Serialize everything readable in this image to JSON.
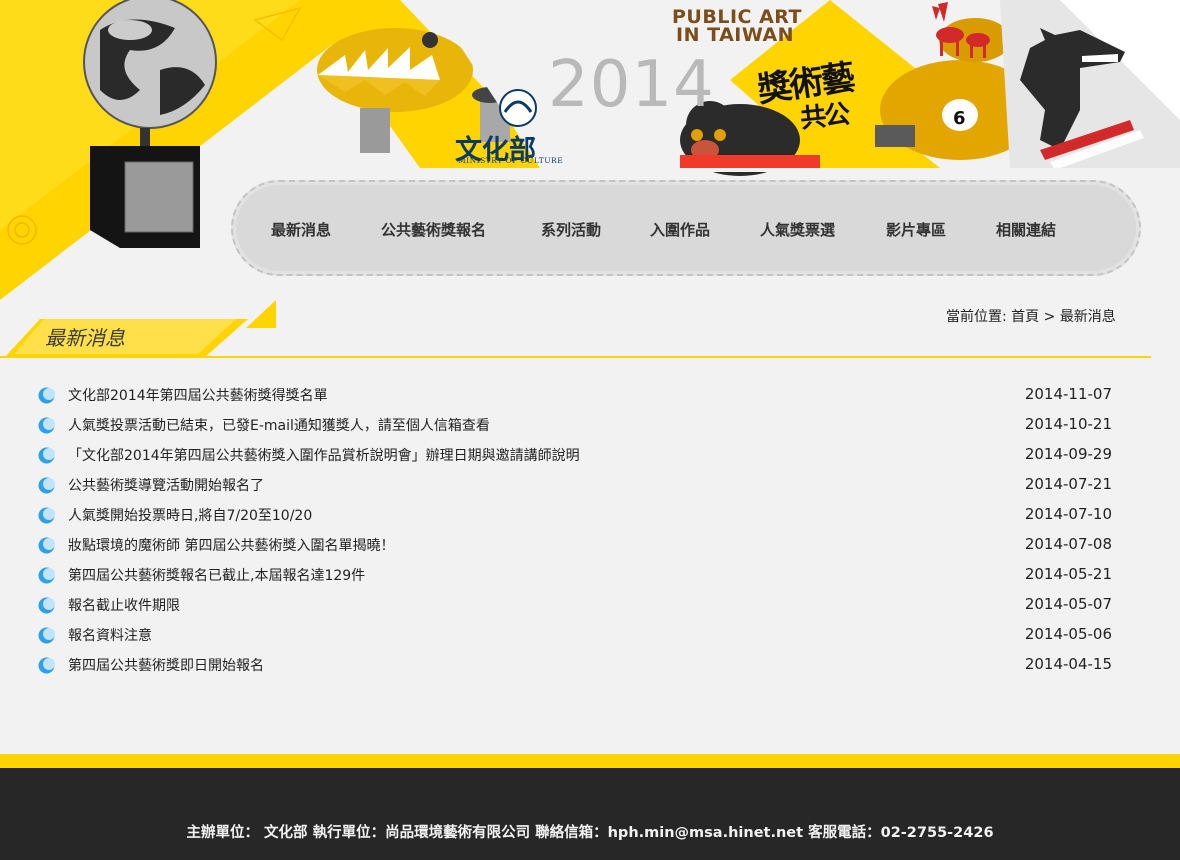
{
  "header": {
    "banner_title_line1": "PUBLIC ART",
    "banner_title_line2": "IN TAIWAN",
    "year": "2014",
    "ministry_name": "文化部",
    "ministry_name_en": "MINISTRY OF CULTURE",
    "calligraphy_line1": "獎術藝",
    "calligraphy_line2": "共公"
  },
  "nav": {
    "items": [
      {
        "label": "最新消息"
      },
      {
        "label": "公共藝術獎報名"
      },
      {
        "label": "系列活動"
      },
      {
        "label": "入圍作品"
      },
      {
        "label": "人氣獎票選"
      },
      {
        "label": "影片專區"
      },
      {
        "label": "相關連結"
      }
    ]
  },
  "section": {
    "title": "最新消息"
  },
  "breadcrumb": {
    "prefix": "當前位置:",
    "home": "首頁",
    "separator": ">",
    "current": "最新消息"
  },
  "news": [
    {
      "title": "文化部2014年第四屆公共藝術獎得獎名單",
      "date": "2014-11-07"
    },
    {
      "title": "人氣獎投票活動已結束，已發E-mail通知獲獎人，請至個人信箱查看",
      "date": "2014-10-21"
    },
    {
      "title": "「文化部2014年第四屆公共藝術獎入圍作品賞析說明會」辦理日期與邀請講師說明",
      "date": "2014-09-29"
    },
    {
      "title": "公共藝術獎導覽活動開始報名了",
      "date": "2014-07-21"
    },
    {
      "title": "人氣獎開始投票時日,將自7/20至10/20",
      "date": "2014-07-10"
    },
    {
      "title": "妝點環境的魔術師 第四屆公共藝術獎入圍名單揭曉！",
      "date": "2014-07-08"
    },
    {
      "title": "第四屆公共藝術獎報名已截止,本屆報名達129件",
      "date": "2014-05-21"
    },
    {
      "title": "報名截止收件期限",
      "date": "2014-05-07"
    },
    {
      "title": "報名資料注意",
      "date": "2014-05-06"
    },
    {
      "title": "第四屆公共藝術獎即日開始報名",
      "date": "2014-04-15"
    }
  ],
  "footer": {
    "text": "主辦單位： 文化部 執行單位：尚品環境藝術有限公司 聯絡信箱：hph.min@msa.hinet.net 客服電話：02-2755-2426"
  },
  "colors": {
    "accent_yellow": "#ffd400",
    "bullet_blue": "#2f9fe6",
    "footer_bg": "#272727"
  }
}
